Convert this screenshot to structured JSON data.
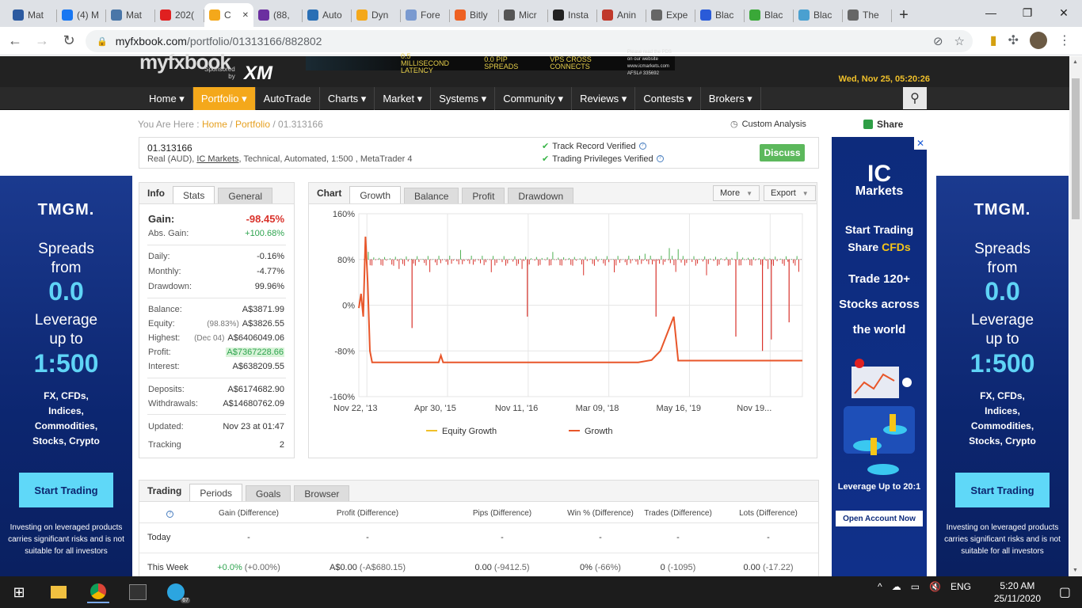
{
  "browser": {
    "tabs": [
      {
        "title": "Mat",
        "fav": "#2c5aa0",
        "icon": "graduation-icon"
      },
      {
        "title": "(4) M",
        "fav": "#1877f2",
        "icon": "facebook-icon"
      },
      {
        "title": "Mat",
        "fav": "#4a76a8",
        "icon": "vk-icon"
      },
      {
        "title": "202(",
        "fav": "#e02020",
        "icon": "opera-icon"
      },
      {
        "title": "C",
        "fav": "#f4a81b",
        "icon": "myfxbook-icon",
        "active": true
      },
      {
        "title": "(88,",
        "fav": "#6b2fa0",
        "icon": "yahoo-mail-icon"
      },
      {
        "title": "Auto",
        "fav": "#2a6fb5",
        "icon": "auto-icon"
      },
      {
        "title": "Dyn",
        "fav": "#f4a81b",
        "icon": "myfxbook-icon"
      },
      {
        "title": "Fore",
        "fav": "#7a9ad0",
        "icon": "forex-icon"
      },
      {
        "title": "Bitly",
        "fav": "#ee6123",
        "icon": "bitly-icon"
      },
      {
        "title": "Micr",
        "fav": "#555",
        "icon": "micro-icon"
      },
      {
        "title": "Insta",
        "fav": "#222",
        "icon": "instagram-icon"
      },
      {
        "title": "Anin",
        "fav": "#c0392b",
        "icon": "anime-icon"
      },
      {
        "title": "Expe",
        "fav": "#666",
        "icon": "expe-icon"
      },
      {
        "title": "Blac",
        "fav": "#2a5bd8",
        "icon": "blackbull-icon"
      },
      {
        "title": "Blac",
        "fav": "#3aa838",
        "icon": "blackbull-green-icon"
      },
      {
        "title": "Blac",
        "fav": "#4aa0d0",
        "icon": "cloud-icon"
      },
      {
        "title": "The",
        "fav": "#666",
        "icon": "globe-icon"
      }
    ],
    "url_host": "myfxbook.com",
    "url_path": "/portfolio/01313166/882802"
  },
  "site": {
    "logo_text": "myfxbook",
    "sponsored": "Sponsored",
    "by": "by",
    "sponsor_name": "XM",
    "banner_items": [
      "0.5 MILLISECOND LATENCY",
      "0.0 PIP SPREADS",
      "VPS CROSS CONNECTS"
    ],
    "banner_fine": "Please read the PDS on our website www.icmarkets.com AFSL# 335692",
    "datetime": "Wed, Nov 25, 05:20:26",
    "nav": [
      {
        "label": "Home ▾"
      },
      {
        "label": "Portfolio ▾",
        "active": true
      },
      {
        "label": "AutoTrade"
      },
      {
        "label": "Charts ▾"
      },
      {
        "label": "Market ▾"
      },
      {
        "label": "Systems ▾"
      },
      {
        "label": "Community ▾"
      },
      {
        "label": "Reviews ▾"
      },
      {
        "label": "Contests ▾"
      },
      {
        "label": "Brokers ▾"
      }
    ]
  },
  "breadcrumb": {
    "prefix": "You Are Here :",
    "home": "Home",
    "portfolio": "Portfolio",
    "current": "01.313166"
  },
  "custom_analysis": "Custom Analysis",
  "share": "Share",
  "account": {
    "id": "01.313166",
    "desc_prefix": "Real (AUD),",
    "broker": "IC Markets",
    "desc_suffix": ", Technical, Automated, 1:500 , MetaTrader 4",
    "verified1": "Track Record Verified",
    "verified2": "Trading Privileges Verified",
    "discuss": "Discuss"
  },
  "info": {
    "tab_label": "Info",
    "tabs": [
      "Stats",
      "General"
    ],
    "gain_label": "Gain:",
    "gain": "-98.45%",
    "absgain_label": "Abs. Gain:",
    "absgain": "+100.68%",
    "daily_label": "Daily:",
    "daily": "-0.16%",
    "monthly_label": "Monthly:",
    "monthly": "-4.77%",
    "drawdown_label": "Drawdown:",
    "drawdown": "99.96%",
    "balance_label": "Balance:",
    "balance": "A$3871.99",
    "equity_label": "Equity:",
    "equity_sub": "(98.83%)",
    "equity": "A$3826.55",
    "highest_label": "Highest:",
    "highest_sub": "(Dec 04)",
    "highest": "A$6406049.06",
    "profit_label": "Profit:",
    "profit": "A$7367228.66",
    "interest_label": "Interest:",
    "interest": "A$638209.55",
    "deposits_label": "Deposits:",
    "deposits": "A$6174682.90",
    "withdrawals_label": "Withdrawals:",
    "withdrawals": "A$14680762.09",
    "updated_label": "Updated:",
    "updated": "Nov 23 at 01:47",
    "tracking_label": "Tracking",
    "tracking": "2"
  },
  "chartpanel": {
    "tab_label": "Chart",
    "tabs": [
      "Growth",
      "Balance",
      "Profit",
      "Drawdown"
    ],
    "more": "More",
    "export": "Export"
  },
  "chart_data": {
    "type": "line",
    "ylim": [
      -160,
      160
    ],
    "y_ticks": [
      "160%",
      "80%",
      "0%",
      "-80%",
      "-160%"
    ],
    "x_ticks": [
      "Nov 22, '13",
      "Apr 30, '15",
      "Nov 11, '16",
      "Mar 09, '18",
      "May 16, '19",
      "Nov 19..."
    ],
    "grid": true,
    "legend": [
      "Equity Growth",
      "Growth"
    ],
    "legend_position": "bottom",
    "series": [
      {
        "name": "Growth",
        "color": "#e8562a",
        "x": [
          0,
          0.5,
          1,
          1.5,
          2,
          2.5,
          3,
          4,
          8,
          18,
          18.5,
          19,
          20,
          30,
          40,
          60,
          63,
          66,
          68,
          70,
          71,
          72,
          73,
          80,
          100
        ],
        "values": [
          -5,
          20,
          -20,
          120,
          40,
          -80,
          -100,
          -100,
          -100,
          -100,
          -88,
          -100,
          -100,
          -100,
          -100,
          -100,
          -100,
          -96,
          -80,
          -40,
          -20,
          -97,
          -97,
          -97,
          -97
        ]
      },
      {
        "name": "Equity Growth",
        "color": "#f0c02a",
        "x": [
          0,
          100
        ],
        "values": [
          80,
          80
        ]
      }
    ]
  },
  "banners": {
    "tmgm": "TMGM.",
    "spreads": "Spreads",
    "from": "from",
    "zero": "0.0",
    "leverage": "Leverage",
    "upto": "up to",
    "ratio": "1:500",
    "products": [
      "FX, CFDs,",
      "Indices,",
      "Commodities,",
      "Stocks, Crypto"
    ],
    "cta": "Start Trading",
    "risk": "Investing on leveraged products carries significant risks and is not suitable for all investors",
    "ic_logo": "IC",
    "ic_logo2": "Markets",
    "ic_line1": "Start Trading",
    "ic_line2_a": "Share",
    "ic_line2_b": "CFDs",
    "ic_line3": [
      "Trade 120+",
      "Stocks across",
      "the world"
    ],
    "ic_leverage": "Leverage Up to 20:1",
    "ic_cta": "Open Account Now"
  },
  "trading": {
    "tab_label": "Trading",
    "tabs": [
      "Periods",
      "Goals",
      "Browser"
    ],
    "headers": [
      "Gain (Difference)",
      "Profit (Difference)",
      "Pips (Difference)",
      "Win % (Difference)",
      "Trades (Difference)",
      "Lots (Difference)"
    ],
    "rows": [
      {
        "label": "Today",
        "cells": [
          [
            "-",
            ""
          ],
          [
            "-",
            ""
          ],
          [
            "-",
            ""
          ],
          [
            "-",
            ""
          ],
          [
            "-",
            ""
          ],
          [
            "-",
            ""
          ]
        ]
      },
      {
        "label": "This Week",
        "cells": [
          [
            "+0.0%",
            "(+0.00%)"
          ],
          [
            "A$0.00",
            "(-A$680.15)"
          ],
          [
            "0.00",
            "(-9412.5)"
          ],
          [
            "0%",
            "(-66%)"
          ],
          [
            "0",
            "(-1095)"
          ],
          [
            "0.00",
            "(-17.22)"
          ]
        ]
      }
    ]
  },
  "taskbar": {
    "lang": "ENG",
    "time": "5:20 AM",
    "date": "25/11/2020",
    "telegram_badge": "67"
  }
}
